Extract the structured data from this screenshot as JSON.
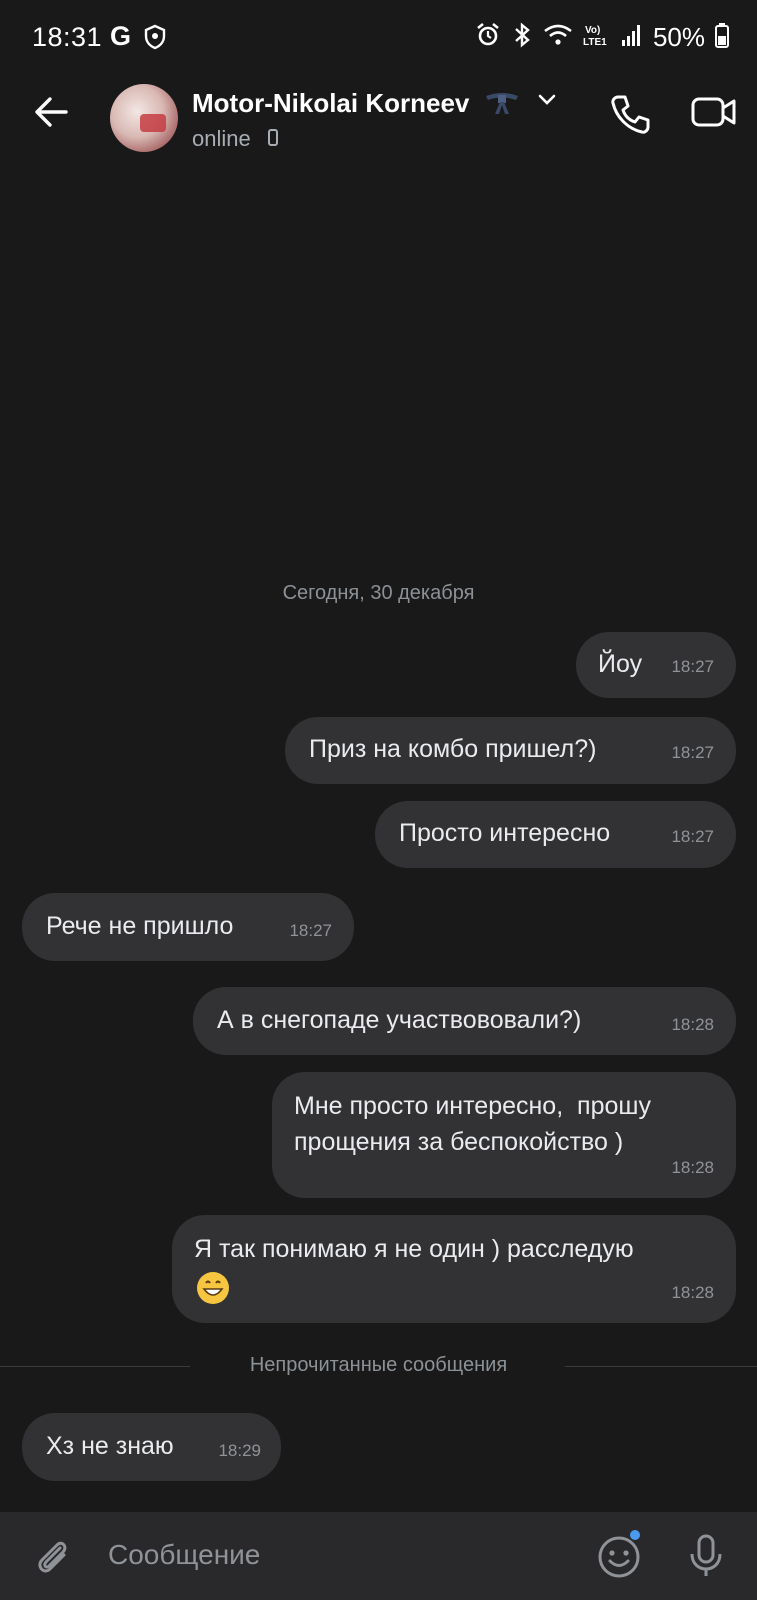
{
  "status_bar": {
    "time": "18:31",
    "google_badge": "G",
    "battery": "50%",
    "icons": [
      "shield-icon",
      "alarm-icon",
      "bluetooth-icon",
      "wifi-icon",
      "volte-icon",
      "signal-icon",
      "battery-icon"
    ]
  },
  "header": {
    "contact_name": "Motor-Nikolai Korneev",
    "status": "online",
    "icons": [
      "back-arrow-icon",
      "belt-icon",
      "chevron-down-icon",
      "phone-icon",
      "video-camera-icon"
    ]
  },
  "chat": {
    "date_separator": "Сегодня, 30 декабря",
    "messages": [
      {
        "dir": "out",
        "text": "Йоу",
        "time": "18:27"
      },
      {
        "dir": "out",
        "text": "Приз на комбо пришел?)",
        "time": "18:27"
      },
      {
        "dir": "out",
        "text": "Просто интересно",
        "time": "18:27"
      },
      {
        "dir": "in",
        "text": "Рече не пришло",
        "time": "18:27"
      },
      {
        "dir": "out",
        "text": "А в снегопаде участвововали?)",
        "time": "18:28"
      },
      {
        "dir": "out",
        "text": "Мне просто интересно,  прошу\nпрощения за беспокойство )",
        "time": "18:28"
      },
      {
        "dir": "out",
        "text": "Я так понимаю я не один ) расследую",
        "emoji": "grinning-face-emoji",
        "time": "18:28"
      },
      {
        "dir": "in",
        "text": "Хз не знаю",
        "time": "18:29"
      }
    ],
    "unread_separator": "Непрочитанные сообщения"
  },
  "composer": {
    "placeholder": "Сообщение",
    "icons": [
      "paperclip-icon",
      "emoji-icon",
      "microphone-icon"
    ],
    "accent": "#4a9bf0"
  },
  "colors": {
    "background": "#19191a",
    "bubble": "#323234",
    "composer": "#29292b"
  }
}
